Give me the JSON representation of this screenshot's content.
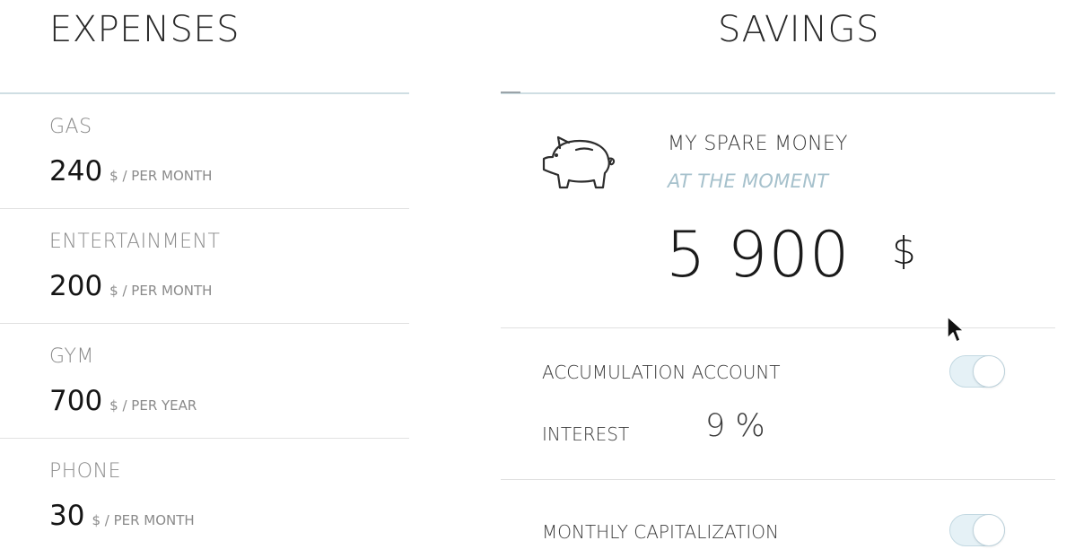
{
  "headings": {
    "expenses": "EXPENSES",
    "savings": "SAVINGS"
  },
  "expenses": [
    {
      "name": "GAS",
      "amount": "240",
      "unit": "$ / PER MONTH"
    },
    {
      "name": "ENTERTAINMENT",
      "amount": "200",
      "unit": "$ / PER MONTH"
    },
    {
      "name": "GYM",
      "amount": "700",
      "unit": "$ / PER YEAR"
    },
    {
      "name": "PHONE",
      "amount": "30",
      "unit": "$ / PER MONTH"
    }
  ],
  "savings": {
    "spare_title": "MY SPARE MONEY",
    "spare_subtitle": "AT THE MOMENT",
    "spare_amount": "5 900",
    "currency": "$",
    "icon": "piggy-bank-icon",
    "accumulation_label": "ACCUMULATION ACCOUNT",
    "accumulation_enabled": true,
    "interest_label": "INTEREST",
    "interest_value": "9 %",
    "monthly_cap_label": "MONTHLY CAPITALIZATION",
    "monthly_cap_enabled": true
  },
  "colors": {
    "accent": "#a6c1cc",
    "toggle_track": "#e5f1f6",
    "divider": "#e1e1e1",
    "header_rule": "#cfdee3"
  }
}
